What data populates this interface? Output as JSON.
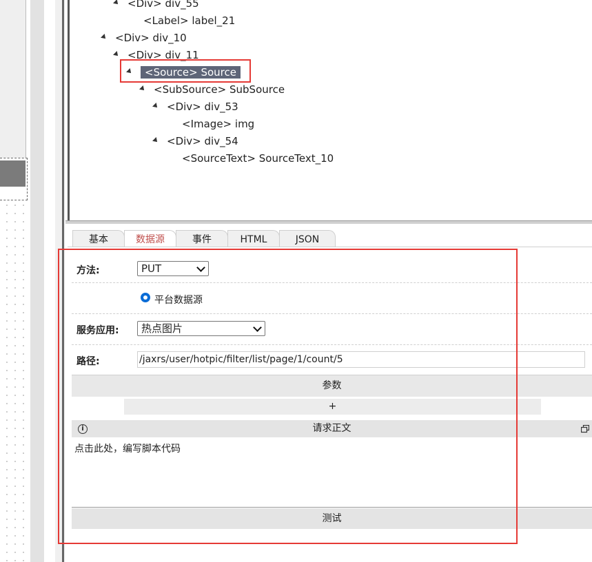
{
  "tree": {
    "nodes": [
      {
        "tag": "<Div>",
        "name": "div_55"
      },
      {
        "tag": "<Label>",
        "name": "label_21"
      },
      {
        "tag": "<Div>",
        "name": "div_10"
      },
      {
        "tag": "<Div>",
        "name": "div_11"
      },
      {
        "tag": "<Source>",
        "name": "Source"
      },
      {
        "tag": "<SubSource>",
        "name": "SubSource"
      },
      {
        "tag": "<Div>",
        "name": "div_53"
      },
      {
        "tag": "<Image>",
        "name": "img"
      },
      {
        "tag": "<Div>",
        "name": "div_54"
      },
      {
        "tag": "<SourceText>",
        "name": "SourceText_10"
      }
    ]
  },
  "tabs": [
    {
      "label": "基本"
    },
    {
      "label": "数据源"
    },
    {
      "label": "事件"
    },
    {
      "label": "HTML"
    },
    {
      "label": "JSON"
    }
  ],
  "form": {
    "method_label": "方法:",
    "method_value": "PUT",
    "source_option": "平台数据源",
    "service_label": "服务应用:",
    "service_value": "热点图片",
    "path_label": "路径:",
    "path_value": "/jaxrs/user/hotpic/filter/list/page/1/count/5",
    "params_title": "参数",
    "add_label": "+",
    "body_title": "请求正文",
    "info_glyph": "i",
    "script_placeholder": "点击此处，编写脚本代码",
    "test_label": "测试"
  },
  "colors": {
    "highlight_box": "#e53935",
    "selected_node_bg": "#5e6578",
    "active_tab_text": "#c0504d",
    "radio": "#0a6cd6"
  }
}
